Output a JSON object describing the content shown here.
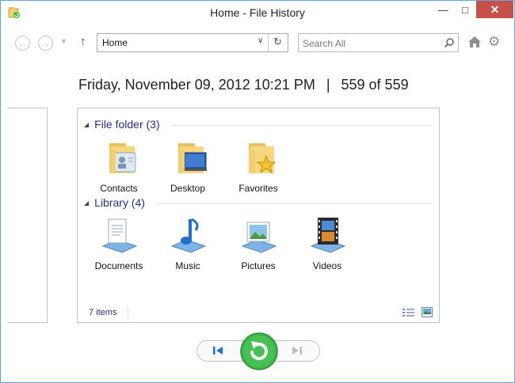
{
  "window": {
    "title": "Home - File History",
    "minimize_glyph": "—",
    "maximize_glyph": "□",
    "close_glyph": "✕"
  },
  "toolbar": {
    "back_glyph": "←",
    "forward_glyph": "→",
    "recent_glyph": "▼",
    "up_glyph": "↑",
    "address_value": "Home",
    "address_dropdown_glyph": "∨",
    "refresh_glyph": "↻",
    "search_placeholder": "Search All",
    "settings_glyph": "⚙"
  },
  "snapshot": {
    "datetime": "Friday, November 09, 2012 10:21 PM",
    "separator": "|",
    "position": "559 of 559"
  },
  "groups": [
    {
      "header": "File folder (3)",
      "items": [
        {
          "label": "Contacts",
          "icon": "contacts-folder-icon"
        },
        {
          "label": "Desktop",
          "icon": "desktop-folder-icon"
        },
        {
          "label": "Favorites",
          "icon": "favorites-folder-icon"
        }
      ]
    },
    {
      "header": "Library (4)",
      "items": [
        {
          "label": "Documents",
          "icon": "documents-library-icon"
        },
        {
          "label": "Music",
          "icon": "music-library-icon"
        },
        {
          "label": "Pictures",
          "icon": "pictures-library-icon"
        },
        {
          "label": "Videos",
          "icon": "videos-library-icon"
        }
      ]
    }
  ],
  "status": {
    "item_count": "7 items"
  },
  "colors": {
    "accent_blue": "#1e3287",
    "close_red": "#c7504a",
    "restore_green": "#3cb54a",
    "folder_yellow": "#f1cf6f"
  }
}
